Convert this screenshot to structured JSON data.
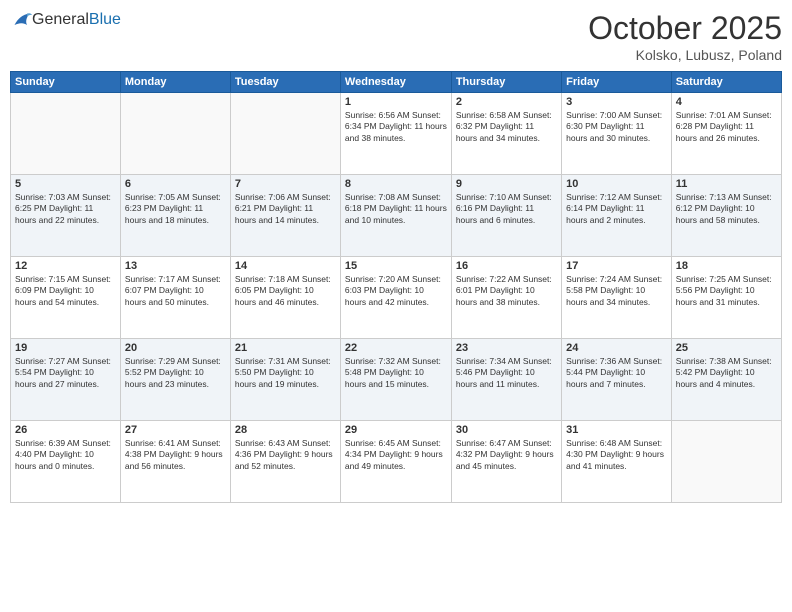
{
  "logo": {
    "general": "General",
    "blue": "Blue"
  },
  "header": {
    "month": "October 2025",
    "location": "Kolsko, Lubusz, Poland"
  },
  "days_of_week": [
    "Sunday",
    "Monday",
    "Tuesday",
    "Wednesday",
    "Thursday",
    "Friday",
    "Saturday"
  ],
  "weeks": [
    {
      "shade": "white",
      "days": [
        {
          "num": "",
          "info": ""
        },
        {
          "num": "",
          "info": ""
        },
        {
          "num": "",
          "info": ""
        },
        {
          "num": "1",
          "info": "Sunrise: 6:56 AM\nSunset: 6:34 PM\nDaylight: 11 hours\nand 38 minutes."
        },
        {
          "num": "2",
          "info": "Sunrise: 6:58 AM\nSunset: 6:32 PM\nDaylight: 11 hours\nand 34 minutes."
        },
        {
          "num": "3",
          "info": "Sunrise: 7:00 AM\nSunset: 6:30 PM\nDaylight: 11 hours\nand 30 minutes."
        },
        {
          "num": "4",
          "info": "Sunrise: 7:01 AM\nSunset: 6:28 PM\nDaylight: 11 hours\nand 26 minutes."
        }
      ]
    },
    {
      "shade": "shaded",
      "days": [
        {
          "num": "5",
          "info": "Sunrise: 7:03 AM\nSunset: 6:25 PM\nDaylight: 11 hours\nand 22 minutes."
        },
        {
          "num": "6",
          "info": "Sunrise: 7:05 AM\nSunset: 6:23 PM\nDaylight: 11 hours\nand 18 minutes."
        },
        {
          "num": "7",
          "info": "Sunrise: 7:06 AM\nSunset: 6:21 PM\nDaylight: 11 hours\nand 14 minutes."
        },
        {
          "num": "8",
          "info": "Sunrise: 7:08 AM\nSunset: 6:18 PM\nDaylight: 11 hours\nand 10 minutes."
        },
        {
          "num": "9",
          "info": "Sunrise: 7:10 AM\nSunset: 6:16 PM\nDaylight: 11 hours\nand 6 minutes."
        },
        {
          "num": "10",
          "info": "Sunrise: 7:12 AM\nSunset: 6:14 PM\nDaylight: 11 hours\nand 2 minutes."
        },
        {
          "num": "11",
          "info": "Sunrise: 7:13 AM\nSunset: 6:12 PM\nDaylight: 10 hours\nand 58 minutes."
        }
      ]
    },
    {
      "shade": "white",
      "days": [
        {
          "num": "12",
          "info": "Sunrise: 7:15 AM\nSunset: 6:09 PM\nDaylight: 10 hours\nand 54 minutes."
        },
        {
          "num": "13",
          "info": "Sunrise: 7:17 AM\nSunset: 6:07 PM\nDaylight: 10 hours\nand 50 minutes."
        },
        {
          "num": "14",
          "info": "Sunrise: 7:18 AM\nSunset: 6:05 PM\nDaylight: 10 hours\nand 46 minutes."
        },
        {
          "num": "15",
          "info": "Sunrise: 7:20 AM\nSunset: 6:03 PM\nDaylight: 10 hours\nand 42 minutes."
        },
        {
          "num": "16",
          "info": "Sunrise: 7:22 AM\nSunset: 6:01 PM\nDaylight: 10 hours\nand 38 minutes."
        },
        {
          "num": "17",
          "info": "Sunrise: 7:24 AM\nSunset: 5:58 PM\nDaylight: 10 hours\nand 34 minutes."
        },
        {
          "num": "18",
          "info": "Sunrise: 7:25 AM\nSunset: 5:56 PM\nDaylight: 10 hours\nand 31 minutes."
        }
      ]
    },
    {
      "shade": "shaded",
      "days": [
        {
          "num": "19",
          "info": "Sunrise: 7:27 AM\nSunset: 5:54 PM\nDaylight: 10 hours\nand 27 minutes."
        },
        {
          "num": "20",
          "info": "Sunrise: 7:29 AM\nSunset: 5:52 PM\nDaylight: 10 hours\nand 23 minutes."
        },
        {
          "num": "21",
          "info": "Sunrise: 7:31 AM\nSunset: 5:50 PM\nDaylight: 10 hours\nand 19 minutes."
        },
        {
          "num": "22",
          "info": "Sunrise: 7:32 AM\nSunset: 5:48 PM\nDaylight: 10 hours\nand 15 minutes."
        },
        {
          "num": "23",
          "info": "Sunrise: 7:34 AM\nSunset: 5:46 PM\nDaylight: 10 hours\nand 11 minutes."
        },
        {
          "num": "24",
          "info": "Sunrise: 7:36 AM\nSunset: 5:44 PM\nDaylight: 10 hours\nand 7 minutes."
        },
        {
          "num": "25",
          "info": "Sunrise: 7:38 AM\nSunset: 5:42 PM\nDaylight: 10 hours\nand 4 minutes."
        }
      ]
    },
    {
      "shade": "white",
      "days": [
        {
          "num": "26",
          "info": "Sunrise: 6:39 AM\nSunset: 4:40 PM\nDaylight: 10 hours\nand 0 minutes."
        },
        {
          "num": "27",
          "info": "Sunrise: 6:41 AM\nSunset: 4:38 PM\nDaylight: 9 hours\nand 56 minutes."
        },
        {
          "num": "28",
          "info": "Sunrise: 6:43 AM\nSunset: 4:36 PM\nDaylight: 9 hours\nand 52 minutes."
        },
        {
          "num": "29",
          "info": "Sunrise: 6:45 AM\nSunset: 4:34 PM\nDaylight: 9 hours\nand 49 minutes."
        },
        {
          "num": "30",
          "info": "Sunrise: 6:47 AM\nSunset: 4:32 PM\nDaylight: 9 hours\nand 45 minutes."
        },
        {
          "num": "31",
          "info": "Sunrise: 6:48 AM\nSunset: 4:30 PM\nDaylight: 9 hours\nand 41 minutes."
        },
        {
          "num": "",
          "info": ""
        }
      ]
    }
  ]
}
